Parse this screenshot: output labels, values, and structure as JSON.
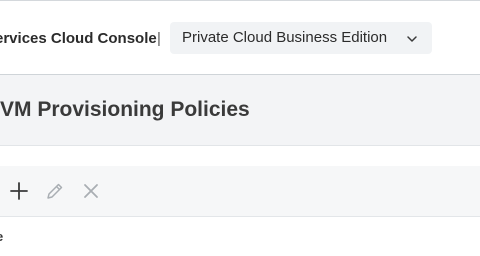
{
  "header": {
    "app_title": "ervices Cloud Console",
    "separator": "|",
    "edition_selector": {
      "value": "Private Cloud Business Edition",
      "icon": "chevron-down-icon"
    }
  },
  "page": {
    "title": "VM Provisioning Policies"
  },
  "toolbar": {
    "buttons": [
      {
        "name": "add",
        "icon": "plus-icon",
        "enabled": true
      },
      {
        "name": "edit",
        "icon": "pencil-icon",
        "enabled": false
      },
      {
        "name": "delete",
        "icon": "close-icon",
        "enabled": false
      }
    ]
  },
  "table": {
    "first_column_header": "e"
  },
  "colors": {
    "text_primary": "#2b2b2b",
    "select_bg": "#f1f3f5",
    "title_band_bg": "#f3f4f6",
    "toolbar_bg": "#f6f7f8",
    "icon_enabled": "#3a3a3a",
    "icon_disabled": "#a9aeb3"
  }
}
